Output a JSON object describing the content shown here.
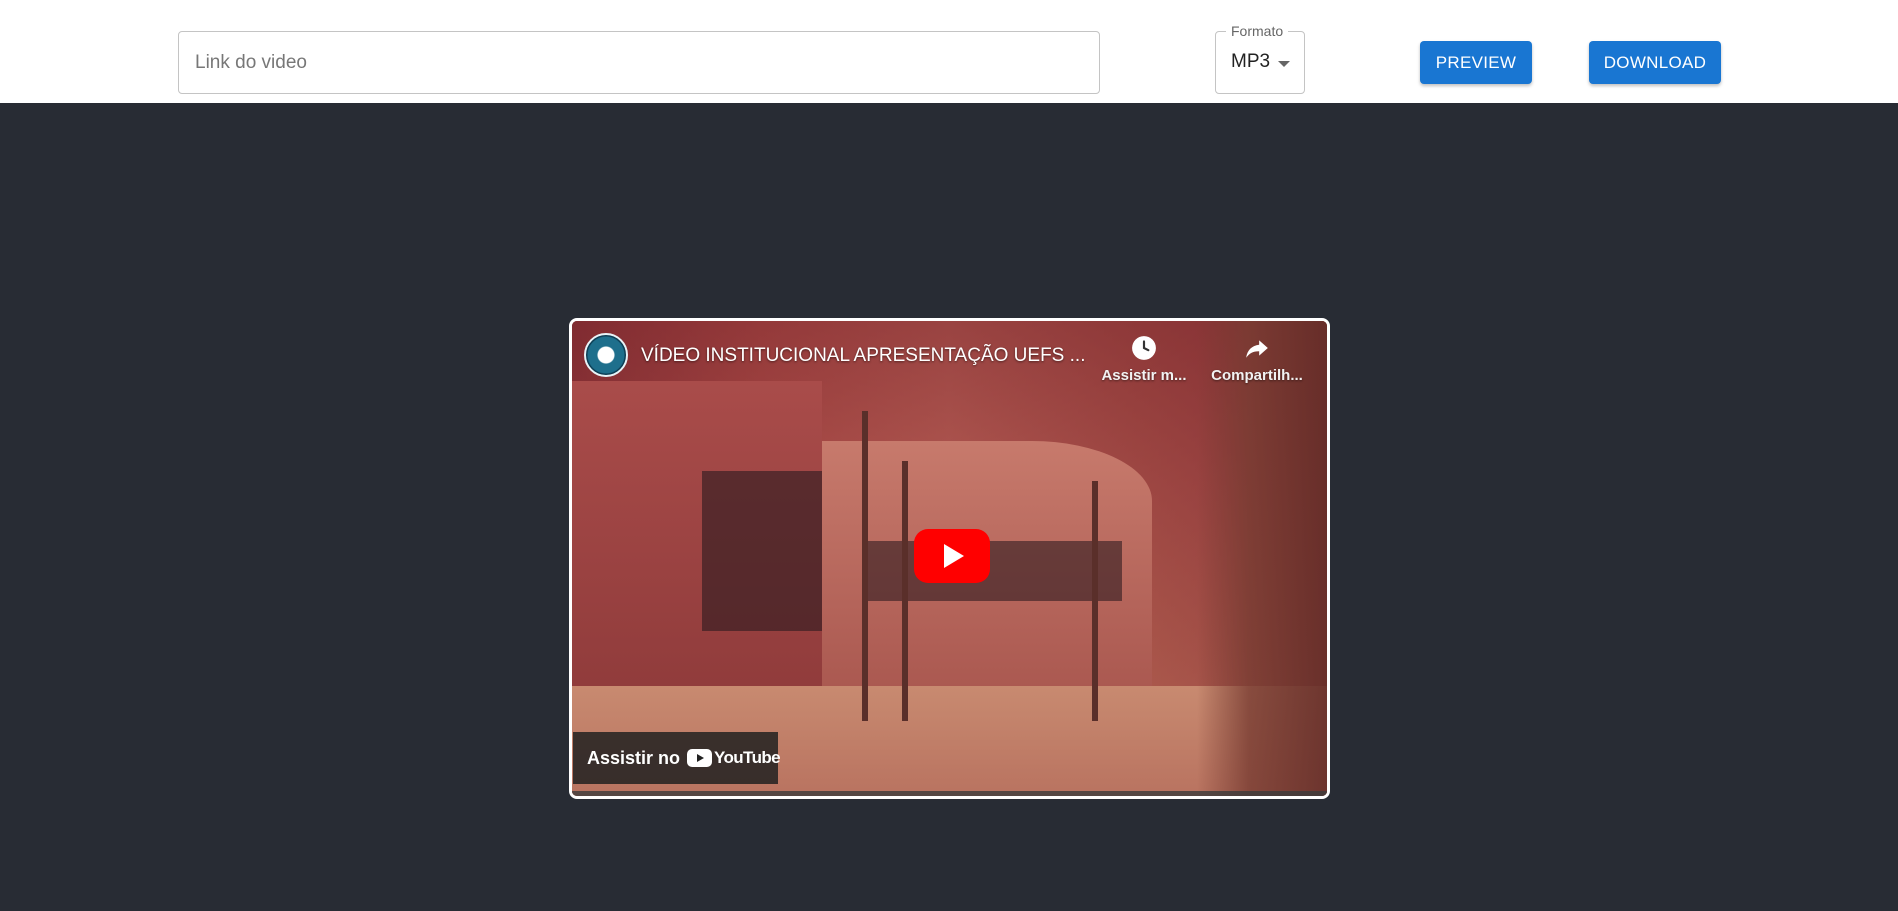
{
  "toolbar": {
    "link_placeholder": "Link do video",
    "link_value": "",
    "format": {
      "label": "Formato",
      "selected": "MP3"
    },
    "preview_label": "PREVIEW",
    "download_label": "DOWNLOAD"
  },
  "player": {
    "title": "VÍDEO INSTITUCIONAL APRESENTAÇÃO UEFS ...",
    "watch_later_label": "Assistir m...",
    "share_label": "Compartilh...",
    "watch_on_label": "Assistir no",
    "brand_label": "YouTube"
  },
  "colors": {
    "accent": "#1976d2",
    "page_background": "#282c34",
    "youtube_red": "#ff0000"
  },
  "icons": {
    "format_caret": "chevron-down-icon",
    "watch_later": "clock-icon",
    "share": "share-icon",
    "play": "play-icon",
    "brand": "youtube-logo-icon"
  }
}
